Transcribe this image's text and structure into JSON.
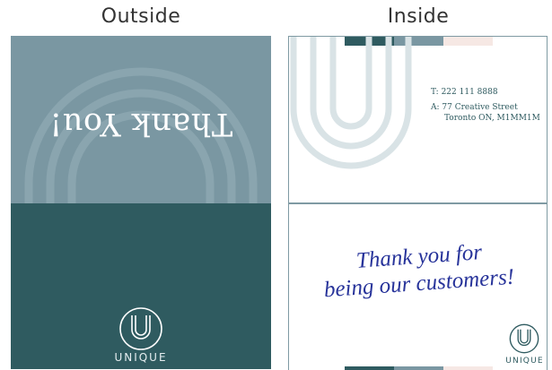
{
  "headings": {
    "outside": "Outside",
    "inside": "Inside"
  },
  "outside": {
    "front_text": "Thank You!",
    "brand": "UNIQUE"
  },
  "inside": {
    "phone": "T: 222 111 8888",
    "address_line1": "A: 77 Creative Street",
    "address_line2": "Toronto ON, M1MM1M",
    "message_line1": "Thank you for",
    "message_line2": "being our customers!",
    "brand": "UNIQUE"
  },
  "colors": {
    "dark_teal": "#2f5b60",
    "slate_blue": "#7a97a2",
    "blush": "#f6e8e4",
    "ink_blue": "#27339a"
  }
}
